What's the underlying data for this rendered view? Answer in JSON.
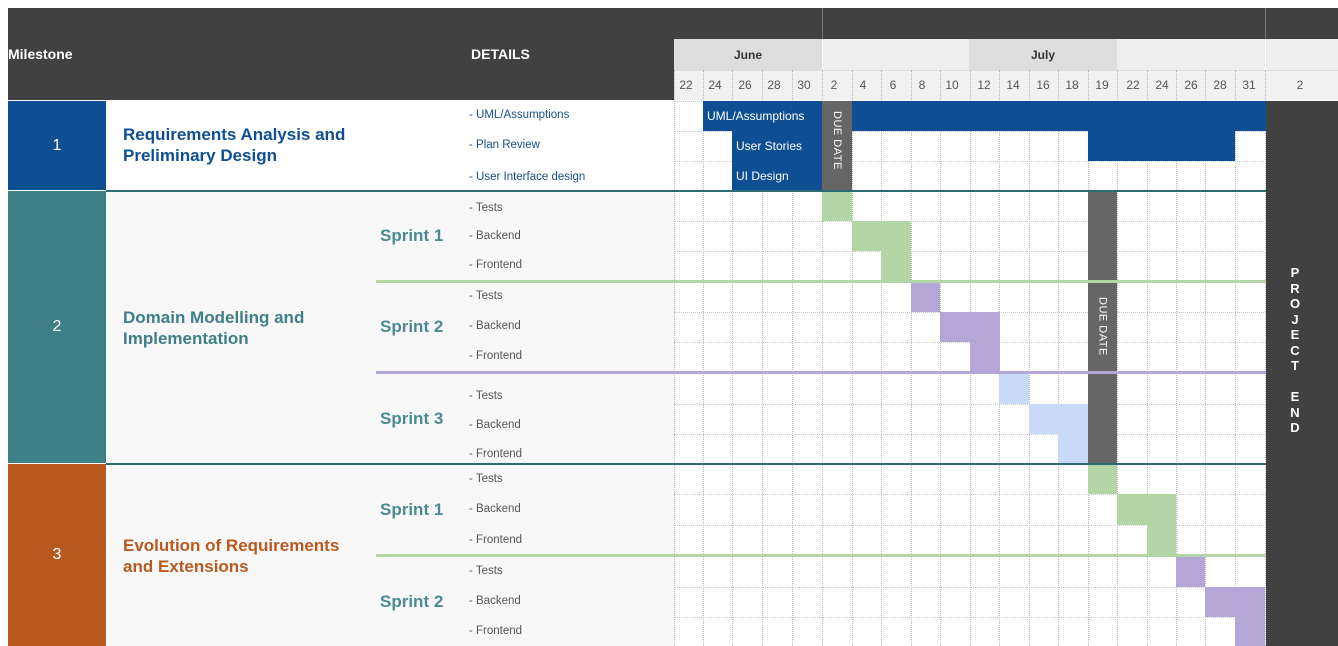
{
  "header": {
    "milestone_label": "Milestone",
    "details_label": "DETAILS",
    "months": [
      "June",
      "July"
    ],
    "days": [
      "22",
      "24",
      "26",
      "28",
      "30",
      "2",
      "4",
      "6",
      "8",
      "10",
      "12",
      "14",
      "16",
      "18",
      "19",
      "22",
      "24",
      "26",
      "28",
      "31",
      "2"
    ]
  },
  "milestones": [
    {
      "number": "1",
      "title_line1": "Requirements Analysis and",
      "title_line2": "Preliminary Design",
      "color": "#0e4f93"
    },
    {
      "number": "2",
      "title_line1": "Domain Modelling and",
      "title_line2": "Implementation",
      "color": "#3f7f88"
    },
    {
      "number": "3",
      "title_line1": "Evolution of Requirements",
      "title_line2": "and Extensions",
      "color": "#b85a20"
    }
  ],
  "milestone1_tasks": [
    "- UML/Assumptions",
    "- Plan Review",
    "- User Interface design"
  ],
  "sprints": [
    {
      "label": "Sprint 1",
      "tasks": [
        "- Tests",
        "- Backend",
        "- Frontend"
      ]
    },
    {
      "label": "Sprint 2",
      "tasks": [
        "- Tests",
        "- Backend",
        "- Frontend"
      ]
    },
    {
      "label": "Sprint 3",
      "tasks": [
        "- Tests",
        "- Backend",
        "- Frontend"
      ]
    },
    {
      "label": "Sprint 1",
      "tasks": [
        "- Tests",
        "- Backend",
        "- Frontend"
      ]
    },
    {
      "label": "Sprint 2",
      "tasks": [
        "- Tests",
        "- Backend",
        "- Frontend"
      ]
    }
  ],
  "bars": {
    "uml": "UML/Assumptions",
    "stories": "User Stories",
    "ui": "UI Design",
    "due_date": "DUE DATE"
  },
  "project_end_letters": [
    "P",
    "R",
    "O",
    "J",
    "E",
    "C",
    "T",
    "",
    "E",
    "N",
    "D"
  ],
  "colors": {
    "blue": "#0e4f93",
    "teal": "#3f7f88",
    "orange": "#b85a20",
    "green": "#b4d5a5",
    "purple": "#b4a7d6",
    "lightblue": "#c9daf8",
    "dark": "#414141",
    "due": "#666666"
  }
}
